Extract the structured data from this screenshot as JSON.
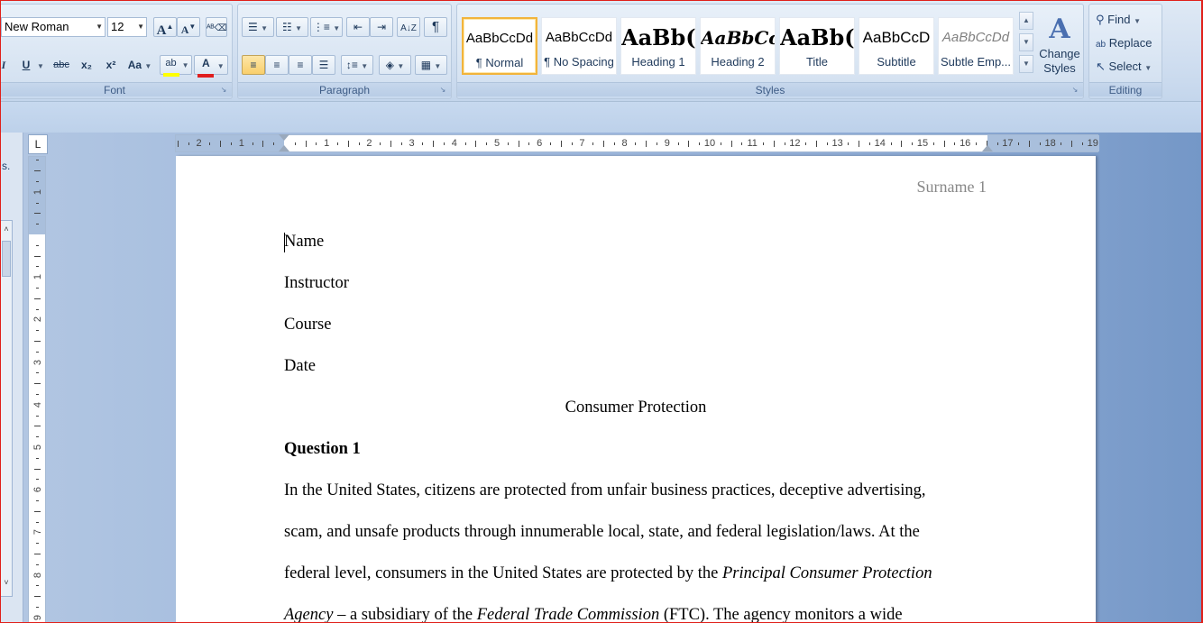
{
  "ribbon": {
    "font": {
      "group_label": "Font",
      "font_name": "New Roman",
      "font_size": "12",
      "grow_label": "A",
      "shrink_label": "A",
      "italic_label": "I",
      "underline_label": "U",
      "strike_label": "abc",
      "subscript_label": "x₂",
      "superscript_label": "x²",
      "case_label": "Aa",
      "highlight_label": "ab",
      "font_color_label": "A",
      "highlight_color": "#ffff00",
      "font_color": "#e01e1e"
    },
    "paragraph": {
      "group_label": "Paragraph",
      "pilcrow": "¶"
    },
    "styles": {
      "group_label": "Styles",
      "items": [
        {
          "sample": "AaBbCcDd",
          "name": "¶ Normal"
        },
        {
          "sample": "AaBbCcDd",
          "name": "¶ No Spacing"
        },
        {
          "sample": "AaBb(",
          "name": "Heading 1"
        },
        {
          "sample": "AaBbCc",
          "name": "Heading 2"
        },
        {
          "sample": "AaBb(",
          "name": "Title"
        },
        {
          "sample": "AaBbCcD",
          "name": "Subtitle"
        },
        {
          "sample": "AaBbCcDd",
          "name": "Subtle Emp..."
        }
      ],
      "change_styles_label_1": "Change",
      "change_styles_label_2": "Styles"
    },
    "editing": {
      "group_label": "Editing",
      "find_label": "Find",
      "replace_label": "Replace",
      "select_label": "Select"
    }
  },
  "navpane": {
    "fragment": "s."
  },
  "ruler": {
    "tab_selector": "L",
    "h_numbers": [
      "2",
      "1",
      "1",
      "2",
      "3",
      "4",
      "5",
      "6",
      "7",
      "8",
      "9",
      "10",
      "11",
      "12",
      "13",
      "14",
      "15",
      "16",
      "17",
      "18",
      "19"
    ],
    "v_numbers": [
      "1",
      "1",
      "2",
      "3",
      "4",
      "5",
      "6",
      "7",
      "8",
      "9"
    ]
  },
  "document": {
    "header": "Surname 1",
    "name": "Name",
    "instructor": "Instructor",
    "course": "Course",
    "date": "Date",
    "title": "Consumer Protection",
    "question": "Question 1",
    "p1_line1": "In the United States, citizens are protected from unfair business practices, deceptive advertising,",
    "p1_line2": "scam, and unsafe products through innumerable local, state, and federal legislation/laws. At the",
    "p1_line3_a": "federal level, consumers in the United States are protected by the ",
    "p1_line3_b": "Principal Consumer Protection",
    "p1_line4_a": "Agency",
    "p1_line4_b": " – a subsidiary of the ",
    "p1_line4_c": "Federal Trade Commission",
    "p1_line4_d": " (FTC). The agency monitors a wide"
  }
}
